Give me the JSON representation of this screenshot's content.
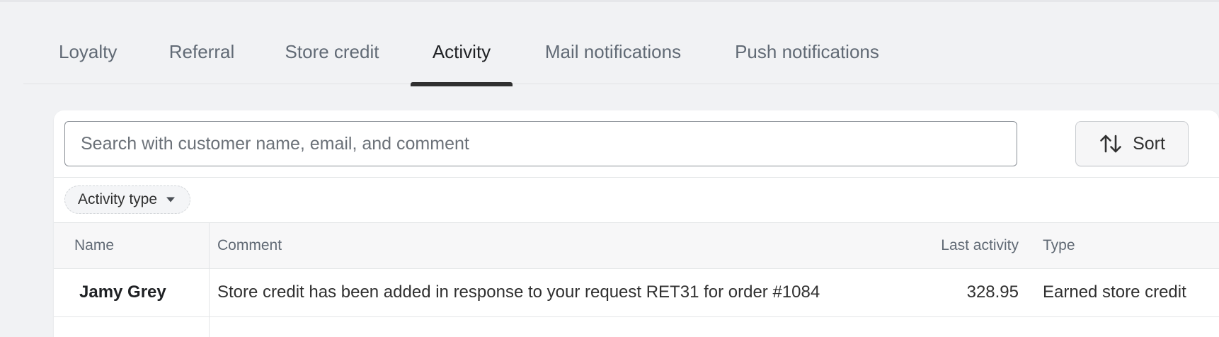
{
  "tabs": [
    {
      "label": "Loyalty"
    },
    {
      "label": "Referral"
    },
    {
      "label": "Store credit"
    },
    {
      "label": "Activity",
      "active": true
    },
    {
      "label": "Mail notifications"
    },
    {
      "label": "Push notifications"
    }
  ],
  "search": {
    "placeholder": "Search with customer name, email, and comment",
    "value": ""
  },
  "sort": {
    "label": "Sort",
    "icon": "sort-arrows-icon"
  },
  "filters": [
    {
      "label": "Activity type",
      "icon": "caret-down-icon"
    }
  ],
  "table": {
    "headers": {
      "name": "Name",
      "comment": "Comment",
      "last_activity": "Last activity",
      "type": "Type"
    },
    "rows": [
      {
        "name": "Jamy Grey",
        "comment": "Store credit has been added in response to your request RET31 for order #1084",
        "last_activity": "328.95",
        "type": "Earned store credit"
      }
    ]
  },
  "colors": {
    "page_bg": "#f1f2f4",
    "card_bg": "#ffffff",
    "active_indicator": "#303030",
    "muted_text": "#616a75"
  }
}
